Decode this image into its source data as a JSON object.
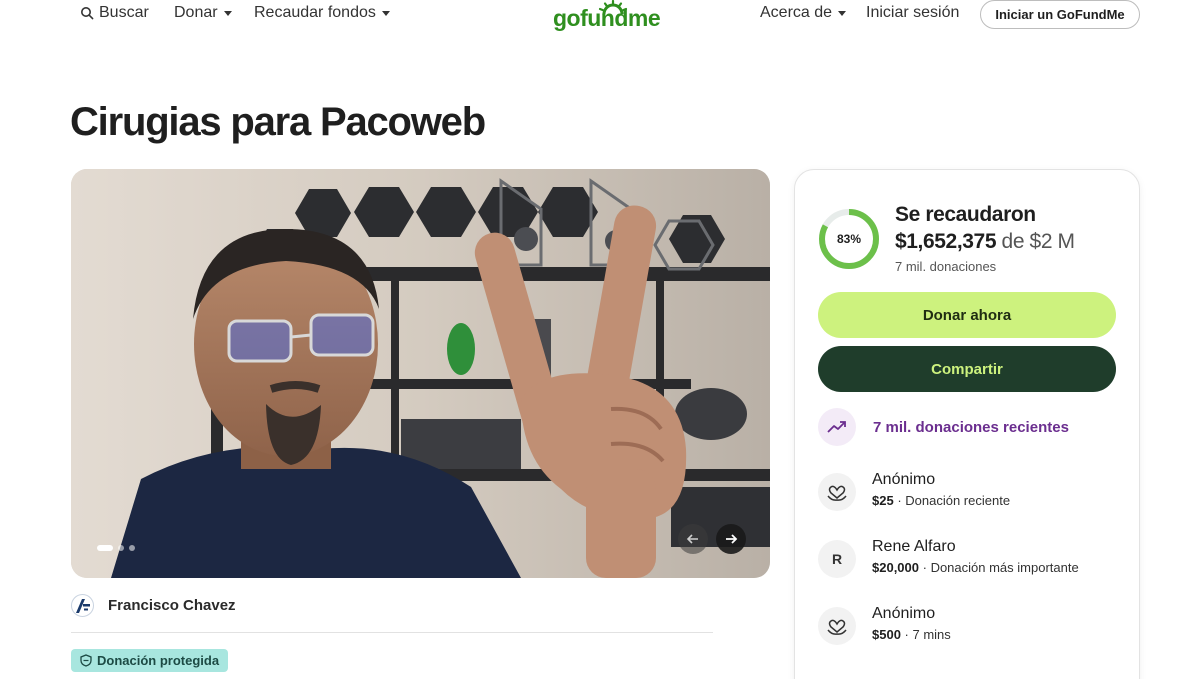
{
  "header": {
    "search_label": "Buscar",
    "donate_menu": "Donar",
    "fundraise_menu": "Recaudar fondos",
    "logo_text": "gofundme",
    "about_menu": "Acerca de",
    "login_label": "Iniciar sesión",
    "start_button": "Iniciar un GoFundMe"
  },
  "campaign": {
    "title": "Cirugias para Pacoweb",
    "organizer": "Francisco Chavez",
    "protected_badge": "Donación protegida",
    "carousel": {
      "slide_count": 3,
      "active_slide": 1
    }
  },
  "summary": {
    "percent": 83,
    "percent_label": "83%",
    "raised_title": "Se recaudaron",
    "raised_amount": "$1,652,375",
    "goal_text": "de $2 M",
    "donation_count": "7 mil. donaciones",
    "donate_button": "Donar ahora",
    "share_button": "Compartir",
    "recent_label": "7 mil. donaciones recientes"
  },
  "donations": [
    {
      "avatar": "heart-hand-icon",
      "name": "Anónimo",
      "amount": "$25",
      "detail": "· Donación reciente"
    },
    {
      "avatar": "R",
      "name": "Rene Alfaro",
      "amount": "$20,000",
      "detail": "· Donación más importante"
    },
    {
      "avatar": "heart-hand-icon",
      "name": "Anónimo",
      "amount": "$500",
      "detail": "· 7 mins"
    }
  ],
  "colors": {
    "brand_green": "#2f8f1f",
    "donate_button": "#cdf27e",
    "share_button": "#1f3d2b",
    "progress_ring": "#6cc04a",
    "recent_purple": "#6b2e8f",
    "protected_badge": "#a8e6df"
  }
}
